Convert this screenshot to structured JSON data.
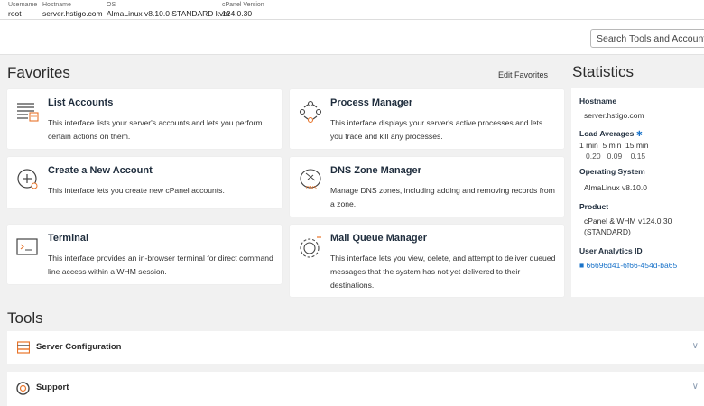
{
  "infobar": {
    "username_label": "Username",
    "username": "root",
    "hostname_label": "Hostname",
    "hostname": "server.hstigo.com",
    "os_label": "OS",
    "os": "AlmaLinux v8.10.0 STANDARD kvm",
    "cpanel_label": "cPanel Version",
    "cpanel": "124.0.30"
  },
  "search": {
    "placeholder": "Search Tools and Accounts"
  },
  "favorites": {
    "heading": "Favorites",
    "edit_label": "Edit Favorites",
    "cards": [
      {
        "title": "List Accounts",
        "desc": "This interface lists your server's accounts and lets you perform certain actions on them.",
        "icon": "list-accounts-icon"
      },
      {
        "title": "Process Manager",
        "desc": "This interface displays your server's active processes and lets you trace and kill any processes.",
        "icon": "process-manager-icon"
      },
      {
        "title": "Create a New Account",
        "desc": "This interface lets you create new cPanel accounts.",
        "icon": "create-account-icon"
      },
      {
        "title": "DNS Zone Manager",
        "desc": "Manage DNS zones, including adding and removing records from a zone.",
        "icon": "dns-zone-icon"
      },
      {
        "title": "Terminal",
        "desc": "This interface provides an in-browser terminal for direct command line access within a WHM session.",
        "icon": "terminal-icon"
      },
      {
        "title": "Mail Queue Manager",
        "desc": "This interface lets you view, delete, and attempt to deliver queued messages that the system has not yet delivered to their destinations.",
        "icon": "mail-queue-icon"
      }
    ]
  },
  "statistics": {
    "heading": "Statistics",
    "hostname_label": "Hostname",
    "hostname": "server.hstigo.com",
    "load_label": "Load Averages",
    "load_headers": "1 min  5 min  15 min",
    "load_values": "0.20   0.09    0.15",
    "os_label": "Operating System",
    "os": "AlmaLinux v8.10.0",
    "product_label": "Product",
    "product_line1": "cPanel & WHM v124.0.30",
    "product_line2": "(STANDARD)",
    "analytics_label": "User Analytics ID",
    "analytics_id": "66696d41-6f66-454d-ba65"
  },
  "tools": {
    "heading": "Tools",
    "items": [
      {
        "label": "Server Configuration",
        "icon": "server-config-icon"
      },
      {
        "label": "Support",
        "icon": "support-icon"
      }
    ]
  },
  "colors": {
    "accent": "#1a73c9",
    "orange": "#e8742a",
    "bg": "#f1f1f1"
  }
}
